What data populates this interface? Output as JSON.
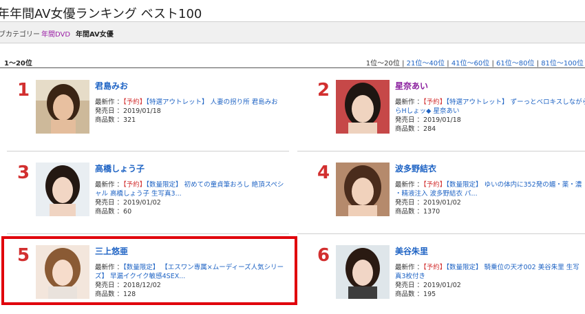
{
  "header": {
    "title": "年年間AV女優ランキング ベスト100"
  },
  "breadcrumb": {
    "label": "ブカテゴリー",
    "link": "年間DVD",
    "current": "年間AV女優"
  },
  "range_label": "1〜20位",
  "pager": {
    "current": "1位〜20位",
    "separator": " | ",
    "links": [
      "21位〜40位",
      "41位〜60位",
      "61位〜80位",
      "81位〜100位"
    ]
  },
  "labels": {
    "latest": "最新作 ：",
    "release": "発売日 ：",
    "count": "商品数 ："
  },
  "colors": {
    "rank": "#d22f2f",
    "link": "#1e63c4",
    "highlight": "#e0000b"
  },
  "ranking": [
    {
      "rank": "1",
      "name": "君島みお",
      "latest_tag": "【予約】",
      "latest_line1": "【特選アウトレット】 人妻の拐り所 君島みお",
      "latest_line2": "",
      "release": "2019/01/18",
      "count": "321"
    },
    {
      "rank": "2",
      "name": "星奈あい",
      "latest_tag": "【予約】",
      "latest_line1": "【特選アウトレット】 ずーっとベロキスしながら",
      "latest_line2": "らHしょッ◆ 星奈あい",
      "release": "2019/01/18",
      "count": "284"
    },
    {
      "rank": "3",
      "name": "高橋しょう子",
      "latest_tag": "【予約】",
      "latest_line1": "【数量限定】 初めての童貞筆おろし 絶頂スペシ",
      "latest_line2": "ャル 高橋しょう子 生写真3...",
      "release": "2019/01/02",
      "count": "60"
    },
    {
      "rank": "4",
      "name": "波多野結衣",
      "latest_tag": "【予約】",
      "latest_line1": "【数量限定】 ゆいの体内に352発の媚・薬・濃",
      "latest_line2": "・精液注入 波多野結衣 パ...",
      "release": "2019/01/02",
      "count": "1370"
    },
    {
      "rank": "5",
      "name": "三上悠亜",
      "latest_tag": "",
      "latest_line1": "【数量限定】 【エスワン専属×ムーディーズ人気シリー",
      "latest_line2": "ズ】 早漏イクイク敏感4SEX...",
      "release": "2018/12/02",
      "count": "128"
    },
    {
      "rank": "6",
      "name": "美谷朱里",
      "latest_tag": "【予約】",
      "latest_line1": "【数量限定】 騎乗位の天才002 美谷朱里 生写",
      "latest_line2": "真3枚付き",
      "release": "2019/01/02",
      "count": "195"
    }
  ]
}
